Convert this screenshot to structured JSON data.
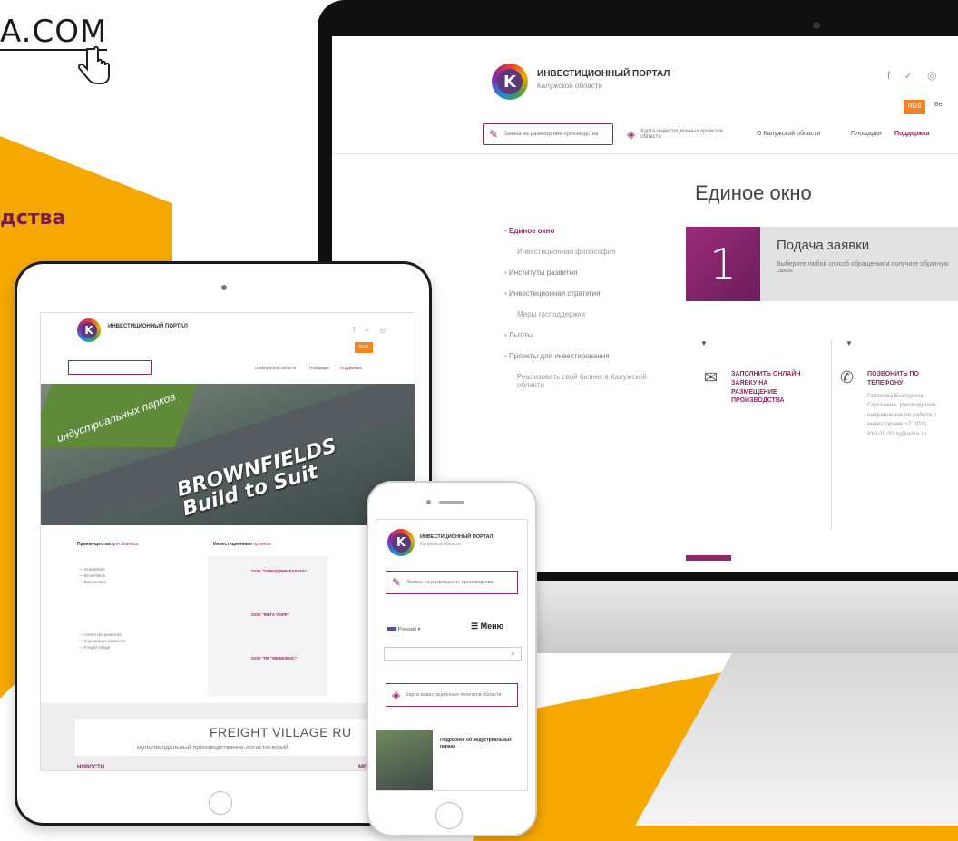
{
  "corner": {
    "link_text": "A.COM",
    "tag_text": "дства"
  },
  "monitor": {
    "header": {
      "title": "ИНВЕСТИЦИОННЫЙ ПОРТАЛ",
      "subtitle": "Калужской области",
      "lang_badge": "RUS",
      "btn_request": "Заявка на размещение производства",
      "btn_map": "Карта инвестиционных проектов области",
      "nav": [
        "О Калужской области",
        "Площадки",
        "Поддержка"
      ]
    },
    "page_title": "Единое окно",
    "sidebar": {
      "active": "Единое окно",
      "items": [
        "Инвестиционная философия",
        "Институты развития",
        "Инвестиционная стратегия",
        "Меры господдержки",
        "Льготы",
        "Проекты для инвестирования",
        "Реализовать свой бизнес в Калужской области"
      ]
    },
    "step": {
      "number": "1",
      "title": "Подача заявки",
      "description": "Выберите любой способ обращения и получите обратную связь"
    },
    "cards": [
      {
        "title": "ЗАПОЛНИТЬ ОНЛАЙН ЗАЯВКУ НА РАЗМЕЩЕНИЕ ПРОИЗВОДСТВА"
      },
      {
        "title": "ПОЗВОНИТЬ ПО ТЕЛЕФОНУ",
        "body": "Гапонова Екатерина Сергеевна, руководитель направления по работе с инвесторами +7 (910) 910-20-02 tg@arika.ru"
      }
    ]
  },
  "tablet": {
    "header_title": "ИНВЕСТИЦИОННЫЙ ПОРТАЛ",
    "lang_badge": "RUS",
    "nav": [
      "О Калужской области",
      "Площадки",
      "Поддержка"
    ],
    "hero_title": "BROWNFIELDS\nBuild to Suit",
    "hero_sub": "индустриальных парков",
    "section_left": "Преимущества",
    "section_left_accent": "для бизнеса",
    "section_mid": "Инвестиционные",
    "section_mid_accent": "проекты",
    "card_rows": [
      "ООО \"ЗАВОД РИК-КАЛУГА\"",
      "ООО \"МЕГА ПАРК\"",
      "ООО \"ПК \"МЕБЕЛЕКС\""
    ],
    "freight_title": "FREIGHT VILLAGE RU",
    "freight_sub": "мультимодальный производственно-логистический",
    "news": "НОВОСТИ",
    "events": "МЕРОПРИ"
  },
  "phone": {
    "title": "ИНВЕСТИЦИОННЫЙ ПОРТАЛ",
    "subtitle": "Калужской области",
    "btn_request": "Заявка на размещение производства",
    "lang": "Русский",
    "menu": "Меню",
    "btn_map": "Карта инвестиционных проектов области",
    "img_title": "Подробнее об индустриальных парках"
  }
}
